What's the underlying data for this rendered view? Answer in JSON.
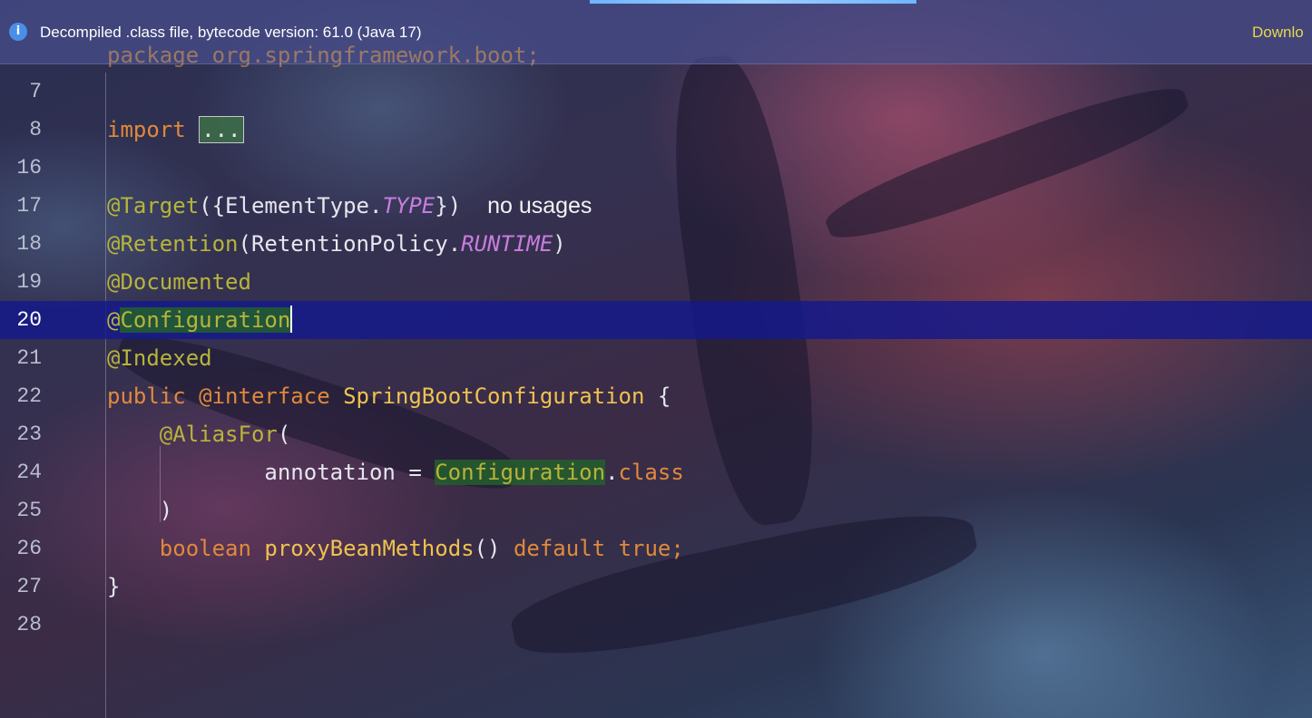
{
  "banner": {
    "message": "Decompiled .class file, bytecode version: 61.0 (Java 17)",
    "action": "Downlo"
  },
  "editor": {
    "partial_first_line": "package org.springframework.boot;",
    "lines": [
      {
        "num": "7"
      },
      {
        "num": "8",
        "kw": "import",
        "fold": "..."
      },
      {
        "num": "16"
      },
      {
        "num": "17",
        "ann": "@Target",
        "p1": "({ElementType.",
        "const": "TYPE",
        "p2": "})",
        "hint": "no usages"
      },
      {
        "num": "18",
        "ann": "@Retention",
        "p1": "(RetentionPolicy.",
        "const": "RUNTIME",
        "p2": ")"
      },
      {
        "num": "19",
        "ann": "@Documented"
      },
      {
        "num": "20",
        "ann_at": "@",
        "ann": "Configuration",
        "current": true
      },
      {
        "num": "21",
        "ann": "@Indexed"
      },
      {
        "num": "22",
        "kw1": "public",
        "kw2": "@interface",
        "cls": "SpringBootConfiguration",
        "rest": " {"
      },
      {
        "num": "23",
        "ann": "@AliasFor",
        "rest": "("
      },
      {
        "num": "24",
        "p1": "annotation = ",
        "hl": "Configuration",
        "dot": ".",
        "kw": "class"
      },
      {
        "num": "25",
        "rest": ")"
      },
      {
        "num": "26",
        "kw": "boolean",
        "cls": "proxyBeanMethods",
        "p1": "() ",
        "kw2": "default",
        "kw3": "true",
        "semi": ";"
      },
      {
        "num": "27",
        "rest": "}"
      },
      {
        "num": "28"
      }
    ]
  },
  "colors": {
    "keyword": "#e0893b",
    "annotation": "#b7b43a",
    "class_name": "#f0c24f",
    "constant": "#c77dde",
    "current_line": "#14198c",
    "banner_link": "#e3d84a"
  }
}
